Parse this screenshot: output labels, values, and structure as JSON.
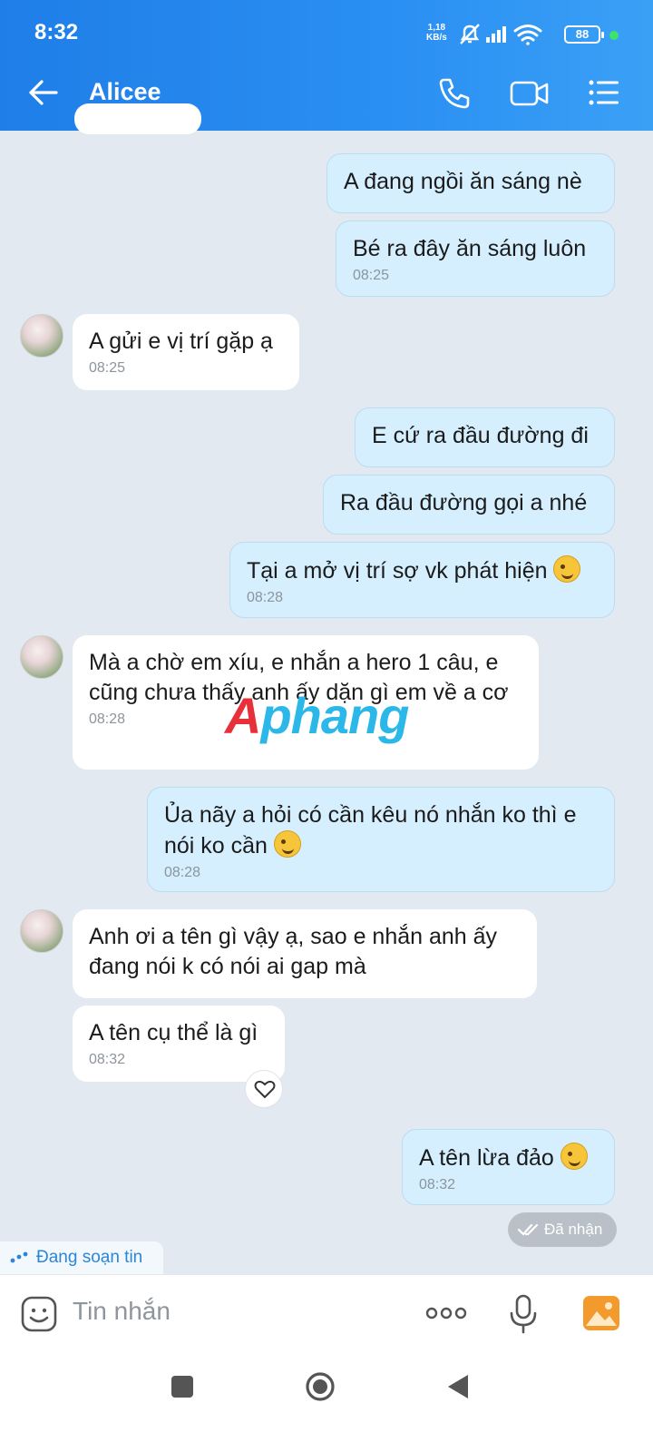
{
  "status_bar": {
    "time": "8:32",
    "speed_value": "1,18",
    "speed_unit": "KB/s",
    "battery": "88"
  },
  "header": {
    "name": "Alicee",
    "icons": [
      "back-arrow-icon",
      "phone-icon",
      "video-call-icon",
      "menu-list-icon"
    ]
  },
  "messages": [
    {
      "side": "out",
      "text": "A đang ngồi ăn sáng nè",
      "time": ""
    },
    {
      "side": "out",
      "text": "Bé ra đây ăn sáng luôn",
      "time": "08:25"
    },
    {
      "side": "in",
      "text": "A gửi e vị trí gặp ạ",
      "time": "08:25"
    },
    {
      "side": "out",
      "text": "E cứ ra đầu đường đi",
      "time": ""
    },
    {
      "side": "out",
      "text": "Ra đầu đường gọi a nhé",
      "time": ""
    },
    {
      "side": "out",
      "text": "Tại a mở vị trí sợ vk phát hiện",
      "emoji": "wink",
      "time": "08:28"
    },
    {
      "side": "in",
      "text": "Mà a chờ em xíu, e nhắn a hero 1 câu, e cũng chưa thấy anh ấy dặn gì em về a cơ",
      "time": "08:28"
    },
    {
      "side": "out",
      "text": "Ủa nãy a hỏi có cần kêu nó nhắn ko thì e nói ko cần",
      "emoji": "laugh",
      "time": "08:28"
    },
    {
      "side": "in",
      "text": "Anh ơi a tên gì vậy ạ, sao e nhắn anh ấy đang nói k có nói ai gap mà",
      "time": ""
    },
    {
      "side": "in",
      "text": "A tên cụ thể là gì",
      "time": "08:32"
    },
    {
      "side": "out",
      "text": "A tên lừa đảo",
      "emoji": "laugh",
      "time": "08:32"
    }
  ],
  "seen_label": "Đã nhận",
  "typing_label": "Đang soạn tin",
  "input": {
    "placeholder": "Tin nhắn"
  },
  "watermark": {
    "part1": "A",
    "part2": "phang"
  },
  "colors": {
    "header": "#2a8ff2",
    "outgoing_bubble": "#d5efff",
    "incoming_bubble": "#ffffff",
    "background": "#e2e9f1",
    "typing_text": "#2a86d8"
  }
}
